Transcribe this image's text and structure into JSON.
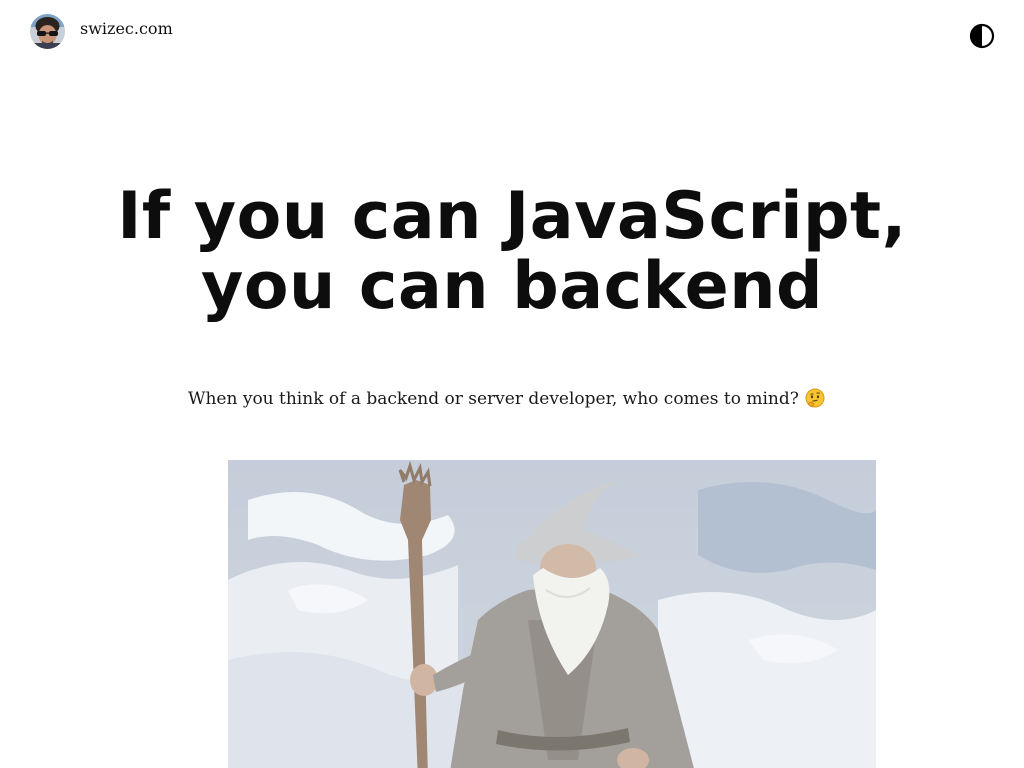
{
  "header": {
    "site_name": "swizec.com",
    "avatar_icon": "avatar-photo",
    "theme_toggle_icon": "half-circle-contrast-icon"
  },
  "post": {
    "title_line1": "If you can JavaScript,",
    "title_line2": "you can backend",
    "lead_text": "When you think of a backend or server developer, who comes to mind?",
    "lead_emoji_icon": "thinking-face-emoji",
    "hero_image_icon": "wizard-illustration"
  },
  "colors": {
    "text": "#111111",
    "background": "#ffffff"
  }
}
